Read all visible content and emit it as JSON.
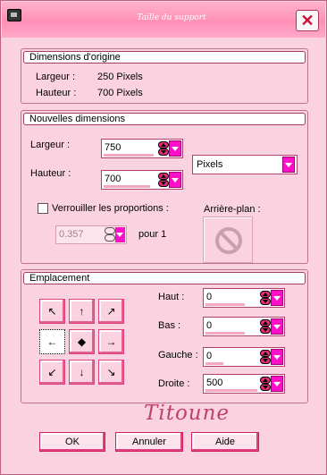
{
  "window": {
    "title": "Taille du support",
    "close_symbol": "✕"
  },
  "origin": {
    "heading": "Dimensions d'origine",
    "width_label": "Largeur :",
    "width_value": "250 Pixels",
    "height_label": "Hauteur :",
    "height_value": "700 Pixels"
  },
  "new_dims": {
    "heading": "Nouvelles dimensions",
    "width_label": "Largeur :",
    "width_value": "750",
    "height_label": "Hauteur :",
    "height_value": "700",
    "unit_selected": "Pixels",
    "lock_label": "Verrouiller les proportions :",
    "lock_checked": false,
    "ratio_value": "0.357",
    "ratio_suffix": "pour 1",
    "background_label": "Arrière-plan :"
  },
  "placement": {
    "heading": "Emplacement",
    "anchors": [
      "↖",
      "↑",
      "↗",
      "←",
      "◆",
      "→",
      "↙",
      "↓",
      "↘"
    ],
    "selected_anchor": "←",
    "haut_label": "Haut :",
    "haut_value": "0",
    "bas_label": "Bas :",
    "bas_value": "0",
    "gauche_label": "Gauche :",
    "gauche_value": "0",
    "droite_label": "Droite :",
    "droite_value": "500"
  },
  "signature": "Titoune",
  "buttons": {
    "ok": "OK",
    "cancel": "Annuler",
    "help": "Aide"
  },
  "colors": {
    "accent": "#ff10c8",
    "title_bar": "#ff8fb6",
    "background": "#fbd3e0"
  }
}
